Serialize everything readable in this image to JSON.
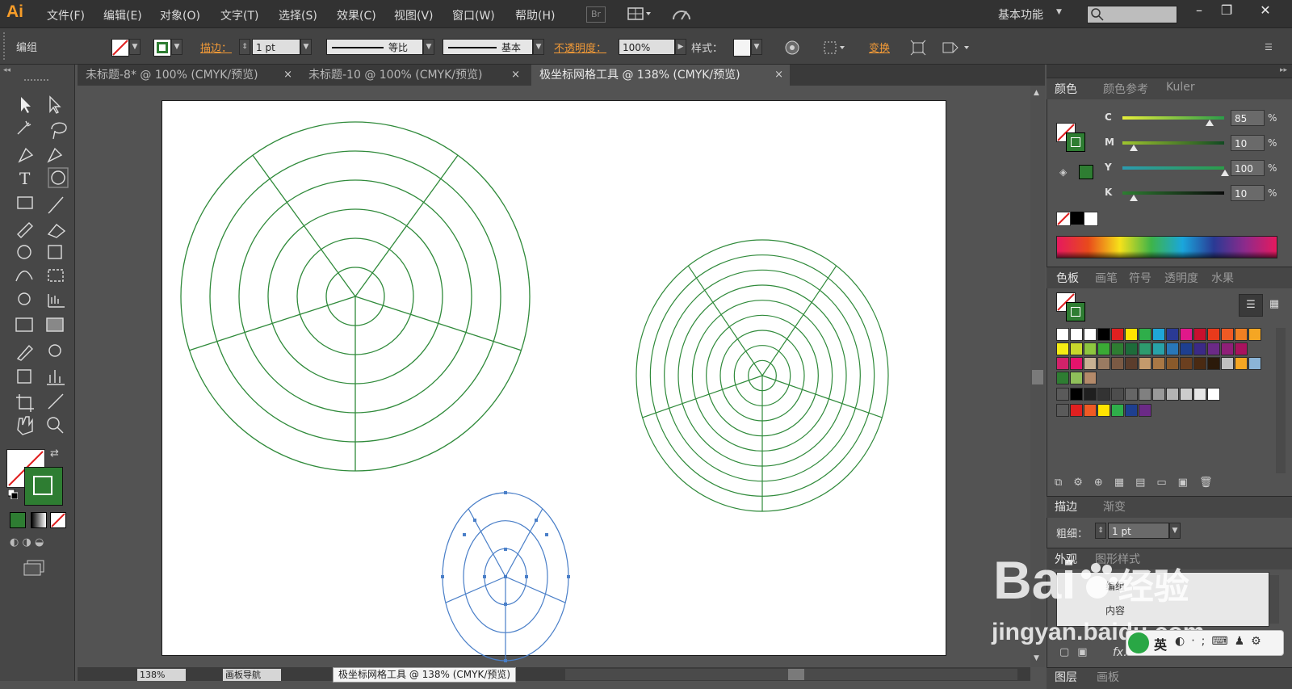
{
  "app": {
    "logo": "Ai"
  },
  "menu": [
    "文件(F)",
    "编辑(E)",
    "对象(O)",
    "文字(T)",
    "选择(S)",
    "效果(C)",
    "视图(V)",
    "窗口(W)",
    "帮助(H)"
  ],
  "menubar": {
    "br": "Br",
    "workspace": "基本功能"
  },
  "control": {
    "selection": "编组",
    "stroke_label": "描边：",
    "stroke_value": "1 pt",
    "profile_label": "等比",
    "brush_label": "基本",
    "opacity_label": "不透明度：",
    "opacity_value": "100%",
    "style_label": "样式：",
    "transform_label": "变换"
  },
  "tabs": [
    {
      "label": "未标题-8* @ 100% (CMYK/预览)"
    },
    {
      "label": "未标题-10 @ 100% (CMYK/预览)"
    },
    {
      "label": "极坐标网格工具 @ 138% (CMYK/预览)"
    }
  ],
  "close_glyph": "×",
  "status": {
    "zoom": "138%",
    "nav": "画板导航",
    "tooltip": "极坐标网格工具 @ 138% (CMYK/预览)"
  },
  "color_panel": {
    "tabs": [
      "颜色",
      "颜色参考",
      "Kuler"
    ],
    "channels": [
      {
        "label": "C",
        "value": "85"
      },
      {
        "label": "M",
        "value": "10"
      },
      {
        "label": "Y",
        "value": "100"
      },
      {
        "label": "K",
        "value": "10"
      }
    ],
    "pct": "%",
    "fill_color": "#2e7d32"
  },
  "swatches_panel": {
    "tabs": [
      "色板",
      "画笔",
      "符号",
      "透明度",
      "水果"
    ]
  },
  "stroke_panel": {
    "tabs": [
      "描边",
      "渐变"
    ],
    "weight_label": "粗细：",
    "weight_value": "1 pt"
  },
  "appearance_panel": {
    "tabs": [
      "外观",
      "图形样式"
    ],
    "row1": "编组",
    "row2": "内容",
    "fx": "fx."
  },
  "layers_panel": {
    "tabs": [
      "图层",
      "画板"
    ]
  },
  "watermark": {
    "brand": "Bai",
    "brand2": "经验",
    "url": "jingyan.baidu.com"
  },
  "ime": {
    "lang": "英"
  },
  "colors": {
    "grid_green": "#2f8a3a",
    "selected_blue": "#4a7fc8",
    "accent_orange": "#f29a37"
  }
}
